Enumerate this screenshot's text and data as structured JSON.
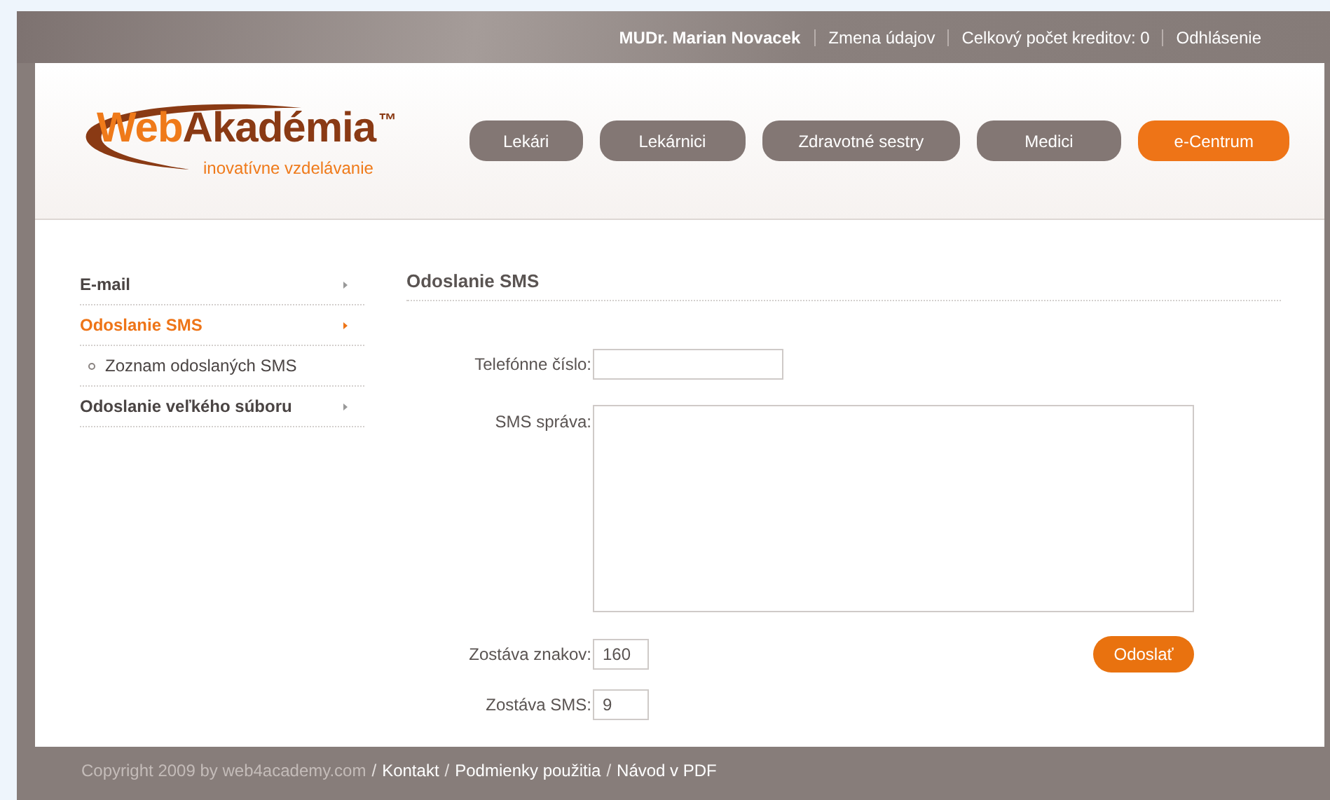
{
  "top_bar": {
    "user": "MUDr. Marian Novacek",
    "links": [
      "Zmena údajov",
      "Celkový počet kreditov: 0",
      "Odhlásenie"
    ]
  },
  "logo": {
    "prefix": "Web",
    "name": "Akadémia",
    "tm": "™",
    "tagline": "inovatívne vzdelávanie"
  },
  "nav": [
    {
      "label": "Lekári",
      "selected": false
    },
    {
      "label": "Lekárnici",
      "selected": false
    },
    {
      "label": "Zdravotné sestry",
      "selected": false
    },
    {
      "label": "Medici",
      "selected": false
    },
    {
      "label": "e-Centrum",
      "selected": true
    }
  ],
  "sidebar": {
    "items": [
      {
        "kind": "item",
        "label": "E-mail",
        "selected": false
      },
      {
        "kind": "item",
        "label": "Odoslanie SMS",
        "selected": true
      },
      {
        "kind": "subitem",
        "label": "Zoznam odoslaných SMS",
        "selected": false
      },
      {
        "kind": "item",
        "label": "Odoslanie veľkého súboru",
        "selected": false
      }
    ]
  },
  "content": {
    "title": "Odoslanie SMS",
    "phone": {
      "label": "Telefónne číslo:"
    },
    "message": {
      "label": "SMS správa:"
    },
    "chars_left": {
      "label": "Zostáva znakov:",
      "value": "160"
    },
    "sms_left": {
      "label": "Zostáva SMS:",
      "value": "9"
    },
    "send_button": "Odoslať"
  },
  "footer": {
    "copyright": "Copyright 2009 by web4academy.com",
    "separator": "/",
    "links": [
      "Kontakt",
      "Podmienky použitia",
      "Návod v PDF"
    ]
  }
}
